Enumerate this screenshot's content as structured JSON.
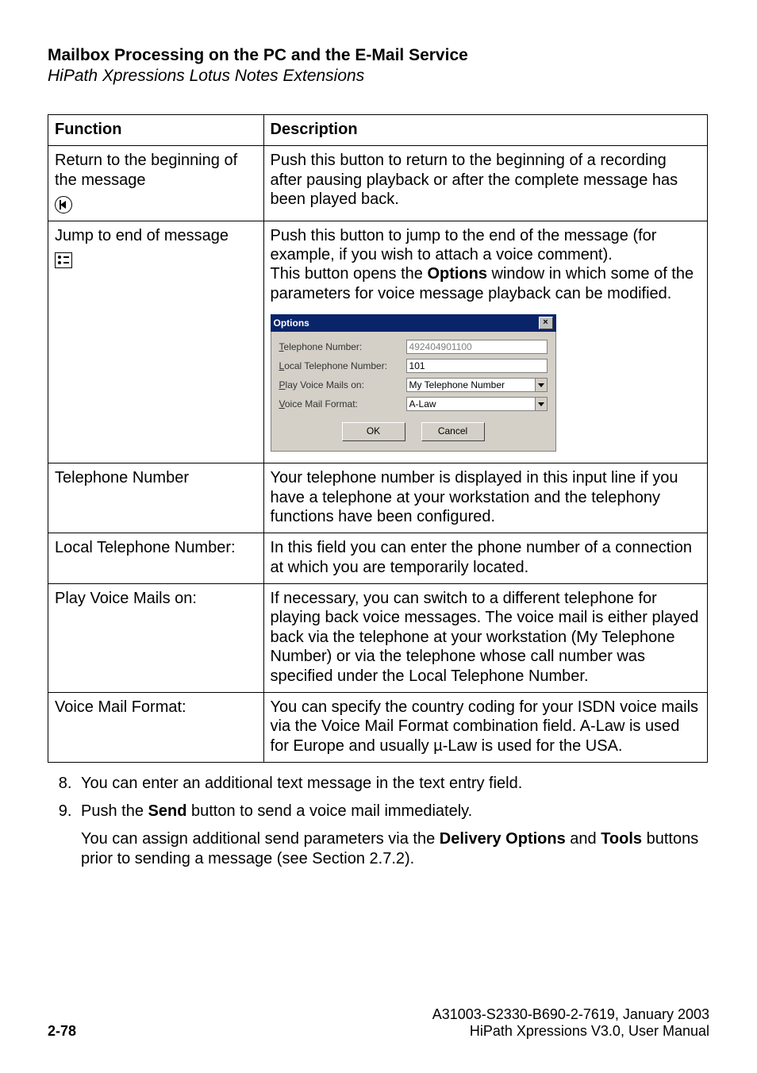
{
  "header": {
    "title": "Mailbox Processing on the PC and the E-Mail Service",
    "subtitle": "HiPath Xpressions Lotus Notes Extensions"
  },
  "table": {
    "head": {
      "func": "Function",
      "desc": "Description"
    },
    "row_return": {
      "func": "Return to the beginning of the message",
      "desc": "Push this button to return to the beginning of a recording after pausing playback or after the complete message has been played back."
    },
    "row_jump": {
      "func": "Jump to end of message",
      "desc_before": "Push this button to jump to the end of the message (for example, if you wish to attach a voice comment).\nThis button opens the ",
      "desc_bold": "Options",
      "desc_after": " window in which some of the parameters for voice message playback can be modified."
    },
    "row_tel": {
      "func": "Telephone Number",
      "desc": "Your telephone number is displayed in this input line if you have a telephone at your workstation and the telephony functions have been configured."
    },
    "row_localtel": {
      "func": "Local Telephone Number:",
      "desc": "In this field you can enter the phone number of a connection at which you are temporarily located."
    },
    "row_play": {
      "func": "Play Voice Mails on:",
      "desc": "If necessary, you can switch to a different telephone for playing back voice messages. The voice mail is either played back via the telephone at your workstation (My Telephone Number) or via the telephone whose call number was specified under the Local Telephone Number."
    },
    "row_vmf": {
      "func": "Voice Mail Format:",
      "desc": "You can specify the country coding for your ISDN voice mails via the Voice Mail Format combination field. A-Law is used for Europe and usually µ-Law is used for the USA."
    }
  },
  "dialog": {
    "title": "Options",
    "labels": {
      "tel_pre": "T",
      "tel_rest": "elephone Number:",
      "local_pre": "L",
      "local_rest": "ocal Telephone Number:",
      "play_pre": "P",
      "play_rest": "lay Voice Mails on:",
      "vmf_pre": "V",
      "vmf_rest": "oice Mail Format:"
    },
    "values": {
      "tel": "492404901100",
      "local": "101",
      "play": "My Telephone Number",
      "vmf": "A-Law"
    },
    "buttons": {
      "ok": "OK",
      "cancel": "Cancel"
    }
  },
  "list": {
    "item8": "You can enter an additional text message in the text entry field.",
    "item9_before": "Push the ",
    "item9_bold": "Send",
    "item9_after": " button to send a voice mail immediately.",
    "after_before": "You can assign additional send parameters via the ",
    "after_bold1": "Delivery Options",
    "after_mid": " and ",
    "after_bold2": "Tools",
    "after_end": " buttons prior to sending a message (see Section 2.7.2)."
  },
  "footer": {
    "page": "2-78",
    "doc1": "A31003-S2330-B690-2-7619, January 2003",
    "doc2": "HiPath Xpressions V3.0, User Manual"
  }
}
